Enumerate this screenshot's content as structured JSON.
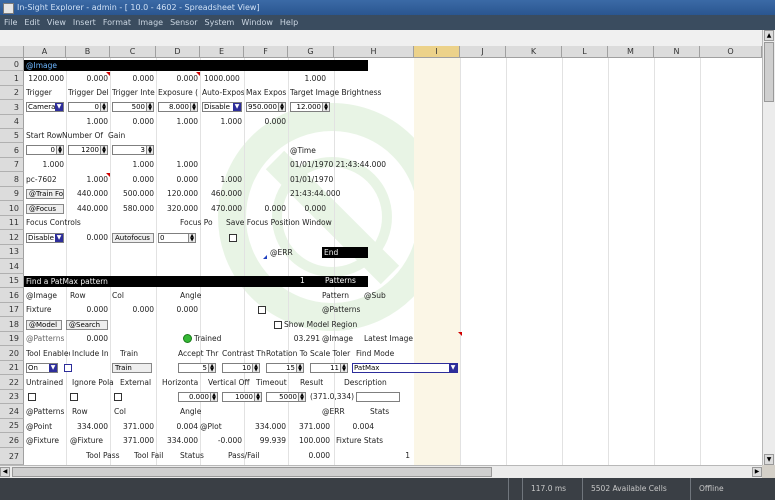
{
  "window": {
    "title": "In-Sight Explorer - admin - [ 10.0 - 4602 - Spreadsheet View]"
  },
  "menu": [
    "File",
    "Edit",
    "View",
    "Insert",
    "Format",
    "Image",
    "Sensor",
    "System",
    "Window",
    "Help"
  ],
  "columns": [
    "A",
    "B",
    "C",
    "D",
    "E",
    "F",
    "G",
    "H",
    "I",
    "J",
    "K",
    "L",
    "M",
    "N",
    "O"
  ],
  "rows": [
    "0",
    "1",
    "2",
    "3",
    "4",
    "5",
    "6",
    "7",
    "8",
    "9",
    "10",
    "11",
    "12",
    "13",
    "14",
    "15",
    "16",
    "17",
    "18",
    "19",
    "20",
    "21",
    "22",
    "23",
    "24",
    "25",
    "26",
    "27"
  ],
  "cells": {
    "a0": "@Image",
    "a1": "1200.000",
    "b1": "0.000",
    "c1": "0.000",
    "d1": "0.000",
    "e1": "1000.000",
    "g1": "1.000",
    "a2": "Trigger",
    "b2": "Trigger Del",
    "c2": "Trigger Inte",
    "d2": "Exposure (",
    "e2": "Auto-Expos",
    "f2": "Max Expos",
    "g2": "Target Image Brightness",
    "a3": "Camera",
    "b3": "0",
    "c3": "500",
    "d3": "8.000",
    "e3": "Disable",
    "f3": "950.000",
    "g3": "12.000",
    "b4": "1.000",
    "c4": "0.000",
    "d4": "1.000",
    "e4": "1.000",
    "f4": "0.000",
    "a5": "Start Row",
    "b5": "Number Of",
    "c5": "Gain",
    "a6": "0",
    "b6": "1200",
    "c6": "3",
    "g6": "@Time",
    "a7": "1.000",
    "c7": "1.000",
    "d7": "1.000",
    "g7": "01/01/1970 21:43:44.000",
    "a8": "pc-7602",
    "b8": "1.000",
    "c8": "0.000",
    "d8": "0.000",
    "e8": "1.000",
    "g8": "01/01/1970",
    "a9": "@Train Fo",
    "b9": "440.000",
    "c9": "500.000",
    "d9": "120.000",
    "e9": "460.000",
    "g9": "21:43:44.000",
    "a10": "@Focus",
    "b10": "440.000",
    "c10": "580.000",
    "d10": "320.000",
    "e10": "470.000",
    "f10": "0.000",
    "g10": "0.000",
    "a11": "Focus Controls",
    "d11": "Focus Po",
    "e11": "Save Focus Position Window",
    "a12": "Disable",
    "b12": "0.000",
    "c12": "Autofocus",
    "d12": "0",
    "f13": "@ERR",
    "g13": "End",
    "a15": "Find a PatMax pattern",
    "f15": "1",
    "g15": "Patterns",
    "a16": "@Image",
    "b16": "Row",
    "c16": "Col",
    "d16": "Angle",
    "g16": "Pattern",
    "h16": "@Sub",
    "a17": "Fixture",
    "b17": "0.000",
    "c17": "0.000",
    "d17": "0.000",
    "g17": "@Patterns",
    "a18": "@Model",
    "b18": "@Search",
    "f18": "Show Model Region",
    "a19": "@Patterns",
    "b19": "0.000",
    "d19": "Trained",
    "f19": "03.291",
    "g19": "@Image",
    "h19": "Latest Image",
    "a20": "Tool Enabled",
    "b20": "Include In",
    "c20": "Train",
    "d20": "Accept Thr",
    "e20": "Contrast Th",
    "f20": "Rotation To",
    "g20": "Scale Toler",
    "h20": "Find Mode",
    "a21": "On",
    "c21": "Train",
    "d21": "5",
    "e21": "10",
    "f21": "15",
    "g21": "11",
    "h21": "PatMax",
    "a22": "Untrained",
    "b22": "Ignore Pola",
    "c22": "External",
    "d22": "Horizonta",
    "e22": "Vertical Off",
    "f22": "Timeout",
    "g22": "Result",
    "h22": "Description",
    "d23": "0.000",
    "e23": "1000",
    "f23": "5000",
    "g23": "(371.0,334)",
    "a24": "@Patterns",
    "b24": "Row",
    "c24": "Col",
    "d24": "Angle",
    "g24": "@ERR",
    "h24": "Stats",
    "a25": "@Point",
    "b25": "334.000",
    "c25": "371.000",
    "d25": "0.004",
    "e25": "@Plot",
    "f25": "334.000",
    "g25": "371.000",
    "h25": "0.004",
    "a26": "@Fixture",
    "b26": "@Fixture",
    "c26": "371.000",
    "d26": "334.000",
    "e26": "-0.000",
    "f26": "99.939",
    "g26": "100.000",
    "h26": "Fixture Stats",
    "b27": "Tool Pass",
    "c27": "Tool Fail",
    "d27": "Status",
    "e27": "Pass/Fail",
    "g27": "0.000",
    "h27": "1"
  },
  "status": {
    "time": "117.0 ms",
    "cells": "5502 Available Cells",
    "mode": "Offline"
  },
  "colors": {
    "title_bg": "#2a5690",
    "menu_bg": "#3a4c5f",
    "status_bg": "#3a3f45",
    "band": "#000000",
    "led": "#35b835"
  }
}
